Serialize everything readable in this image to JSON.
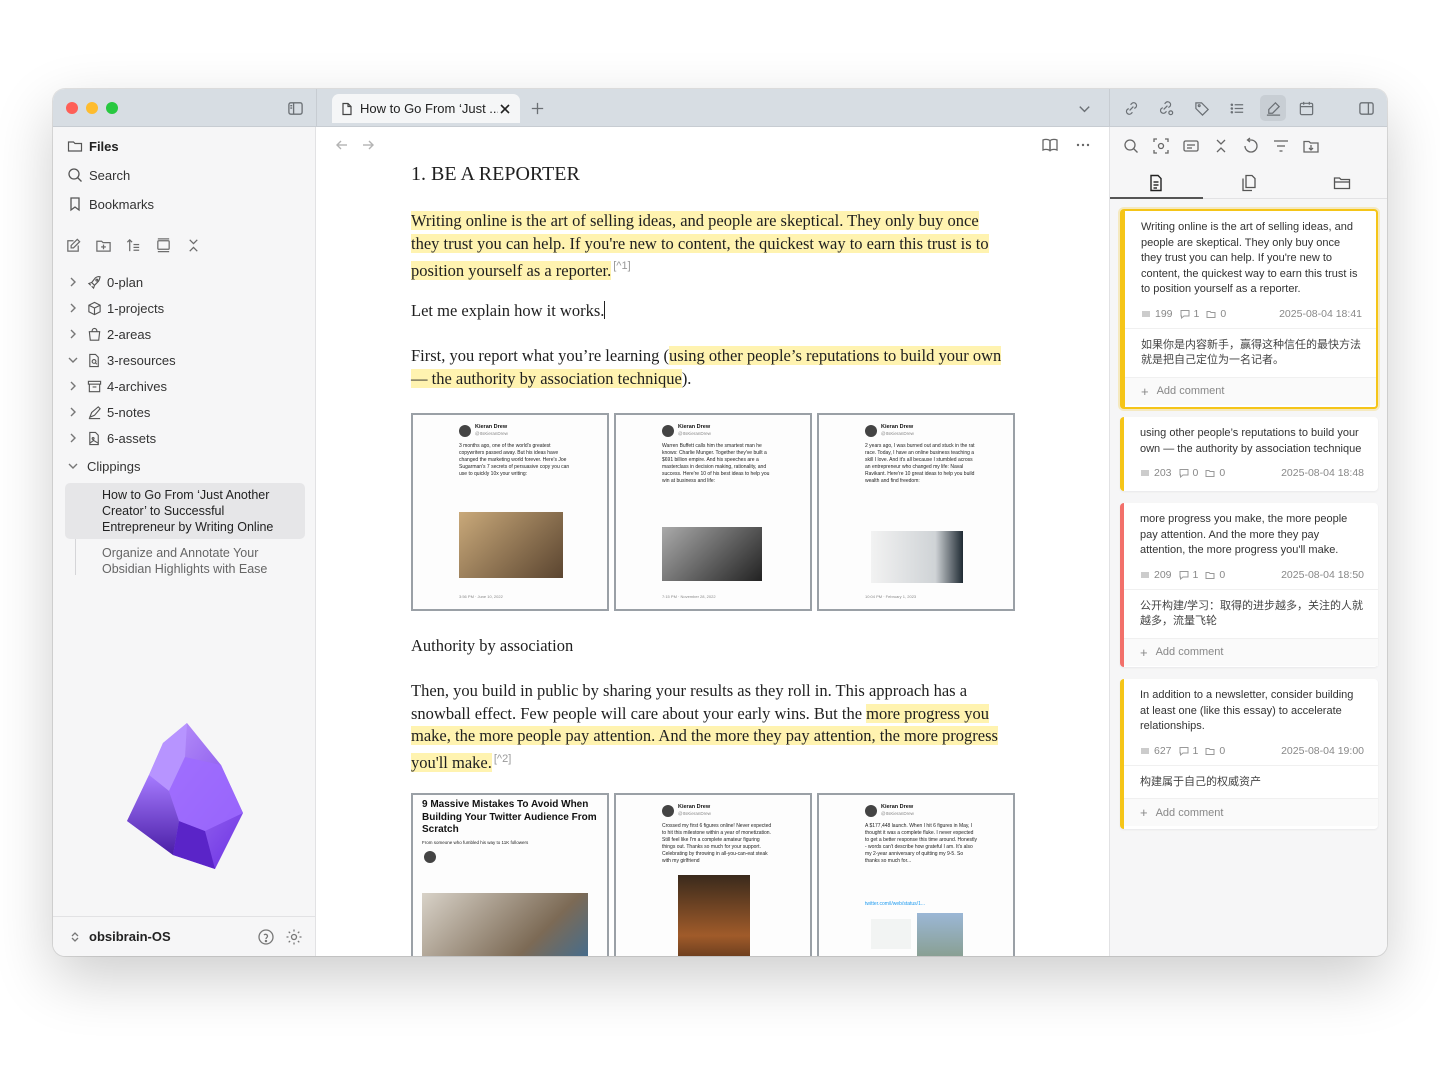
{
  "tab": {
    "title": "How to Go From ‘Just ..."
  },
  "sidebar": {
    "files": "Files",
    "search": "Search",
    "bookmarks": "Bookmarks",
    "folders": [
      {
        "label": "0-plan"
      },
      {
        "label": "1-projects"
      },
      {
        "label": "2-areas"
      },
      {
        "label": "3-resources"
      },
      {
        "label": "4-archives"
      },
      {
        "label": "5-notes"
      },
      {
        "label": "6-assets"
      }
    ],
    "clippings": "Clippings",
    "clip_items": [
      "How to Go From ‘Just Another Creator’ to Successful Entrepreneur by Writing Online",
      "Organize and Annotate Your Obsidian Highlights with Ease"
    ],
    "vault_name": "obsibrain-OS"
  },
  "editor": {
    "heading": "1. BE A REPORTER",
    "p1": "Writing online is the art of selling ideas, and people are skeptical. They only buy once they trust you can help. If you're new to content, the quickest way to earn this trust is to position yourself as a reporter.",
    "fn1": "[^1]",
    "p2": "Let me explain how it works.",
    "p3_pre": "First, you report what you’re learning (",
    "p3_hl": "using other people’s reputations to build your own — the authority by association technique",
    "p3_post": ").",
    "authority": "Authority by association",
    "p4_pre": "Then, you build in public by sharing your results as they roll in. This approach has a snowball effect. Few people will care about your early wins. But the ",
    "p4_hl": "more progress you make, the more people pay attention. And the more they pay attention, the more progress you'll make.",
    "fn2": "[^2]",
    "tweets_row1": [
      {
        "name": "Kieran Drew",
        "handle": "@ItsKieranDrew",
        "text": "3 months ago, one of the world's greatest copywriters passed away. But his ideas have changed the marketing world forever. Here's Joe Sugarman's 7 secrets of persuasive copy you can use to quickly 10x your writing:",
        "footer": "3:56 PM · June 10, 2022"
      },
      {
        "name": "Kieran Drew",
        "handle": "@ItsKieranDrew",
        "text": "Warren Buffett calls him the smartest man he knows: Charlie Munger. Together they've built a $691 billion empire. And his speeches are a masterclass in decision making, rationality, and success. Here're 10 of his best ideas to help you win at business and life:",
        "footer": "7:15 PM · November 28, 2022"
      },
      {
        "name": "Kieran Drew",
        "handle": "@ItsKieranDrew",
        "text": "2 years ago, I was burned out and stuck in the rat race. Today, I have an online business teaching a skill I love. And it's all because I stumbled across an entrepreneur who changed my life: Naval Ravikant. Here're 10 great ideas to help you build wealth and find freedom:",
        "footer": "10:04 PM · February 1, 2023"
      }
    ],
    "tweets_row2": [
      {
        "title": "9 Massive Mistakes To Avoid When Building Your Twitter Audience From Scratch",
        "sub": "From someone who fumbled his way to 11K followers"
      },
      {
        "name": "Kieran Drew",
        "handle": "@ItsKieranDrew",
        "text": "Crossed my first 6 figures online! Never expected to hit this milestone within a year of monetization. Still feel like I'm a complete amateur figuring things out. Thanks so much for your support. Celebrating by throwing in all-you-can-eat steak with my girlfriend"
      },
      {
        "name": "Kieran Drew",
        "handle": "@ItsKieranDrew",
        "text": "A $177,448 launch. When I hit 6 figures in May, I thought it was a complete fluke. I never expected to get a better response this time around. Honestly - words can't describe how grateful I am. It's also my 2-year anniversary of quitting my 9-5. So thanks so much for...",
        "link": "twitter.com/i/web/status/1..."
      }
    ]
  },
  "right_panel": {
    "cards": [
      {
        "text": "Writing online is the art of selling ideas, and people are skeptical. They only buy once they trust you can help. If you're new to content, the quickest way to earn this trust is to position yourself as a reporter.",
        "words": "199",
        "comments": "1",
        "links": "0",
        "date": "2025-08-04 18:41",
        "comment": "如果你是内容新手，赢得这种信任的最快方法就是把自己定位为一名记者。",
        "add": "Add comment",
        "color": "#f5c518"
      },
      {
        "text": "using other people’s reputations to build your own — the authority by association technique",
        "words": "203",
        "comments": "0",
        "links": "0",
        "date": "2025-08-04 18:48",
        "color": "#f5c518"
      },
      {
        "text": "more progress you make, the more people pay attention. And the more they pay attention, the more progress you'll make.",
        "words": "209",
        "comments": "1",
        "links": "0",
        "date": "2025-08-04 18:50",
        "comment": "公开构建/学习：取得的进步越多，关注的人就越多，流量飞轮",
        "add": "Add comment",
        "color": "#f2706a"
      },
      {
        "text": "In addition to a newsletter, consider building at least one (like this essay) to accelerate relationships.",
        "words": "627",
        "comments": "1",
        "links": "0",
        "date": "2025-08-04 19:00",
        "comment": "构建属于自己的权威资产",
        "add": "Add comment",
        "color": "#f5c518"
      }
    ]
  }
}
